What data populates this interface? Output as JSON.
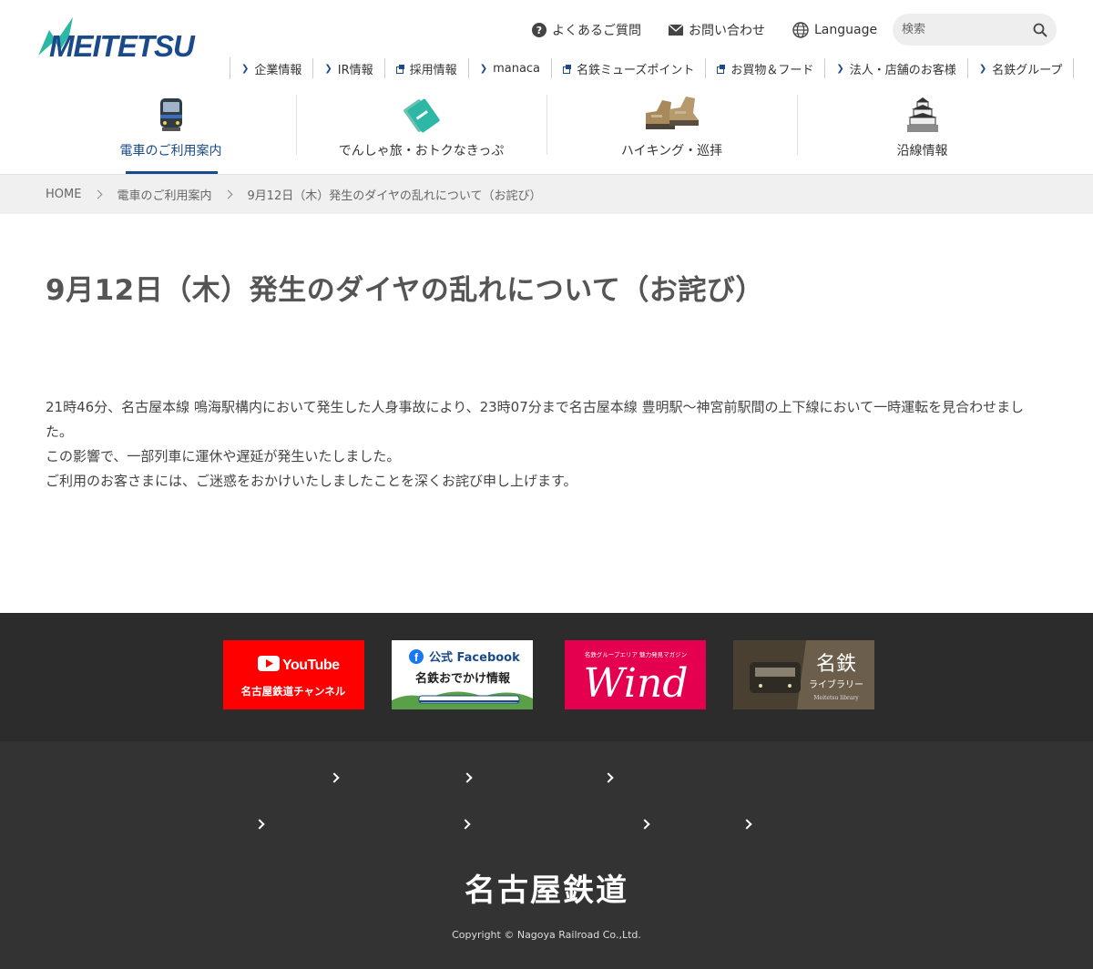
{
  "brand": {
    "logo_text": "MEITETSU",
    "logo_color": "#1a4a8a",
    "accent": "#2db8a6"
  },
  "util_nav": [
    {
      "label": "よくあるご質問",
      "icon": "question-circle-icon"
    },
    {
      "label": "お問い合わせ",
      "icon": "mail-icon"
    },
    {
      "label": "Language",
      "icon": "globe-icon"
    }
  ],
  "search": {
    "placeholder": "検索",
    "icon": "search-icon"
  },
  "sub_nav": [
    {
      "label": "企業情報",
      "marker": "chevron"
    },
    {
      "label": "IR情報",
      "marker": "chevron"
    },
    {
      "label": "採用情報",
      "marker": "external"
    },
    {
      "label": "manaca",
      "marker": "chevron"
    },
    {
      "label": "名鉄ミューズポイント",
      "marker": "external"
    },
    {
      "label": "お買物＆フード",
      "marker": "external"
    },
    {
      "label": "法人・店舗のお客様",
      "marker": "chevron"
    },
    {
      "label": "名鉄グループ",
      "marker": "chevron"
    }
  ],
  "global_nav": [
    {
      "label": "電車のご利用案内",
      "icon": "train-icon",
      "active": true
    },
    {
      "label": "でんしゃ旅・おトクなきっぷ",
      "icon": "ticket-icon",
      "active": false
    },
    {
      "label": "ハイキング・巡拝",
      "icon": "hiking-boots-icon",
      "active": false
    },
    {
      "label": "沿線情報",
      "icon": "castle-icon",
      "active": false
    }
  ],
  "breadcrumb": [
    "HOME",
    "電車のご利用案内",
    "9月12日（木）発生のダイヤの乱れについて（お詫び）"
  ],
  "page": {
    "title": "9月12日（木）発生のダイヤの乱れについて（お詫び）",
    "paragraphs": [
      "21時46分、名古屋本線 鳴海駅構内において発生した人身事故により、23時07分まで名古屋本線 豊明駅～神宮前駅間の上下線において一時運転を見合わせました。",
      "この影響で、一部列車に運休や遅延が発生いたしました。",
      "ご利用のお客さまには、ご迷惑をおかけいたしましたことを深くお詫び申し上げます。"
    ]
  },
  "banners": {
    "youtube": {
      "logo": "YouTube",
      "caption": "名古屋鉄道チャンネル",
      "color": "#ff0000"
    },
    "facebook": {
      "head": "公式 Facebook",
      "caption": "名鉄おでかけ情報",
      "color": "#1a4a8a"
    },
    "wind": {
      "small": "名鉄グループエリア 魅力発見マガジン",
      "logo": "Wind",
      "color": "#e5004f"
    },
    "library": {
      "title": "名鉄",
      "sub": "ライブラリー",
      "en": "Meitetsu library"
    }
  },
  "footer": {
    "company_name": "名古屋鉄道",
    "copyright": "Copyright © Nagoya Railroad Co.,Ltd."
  }
}
